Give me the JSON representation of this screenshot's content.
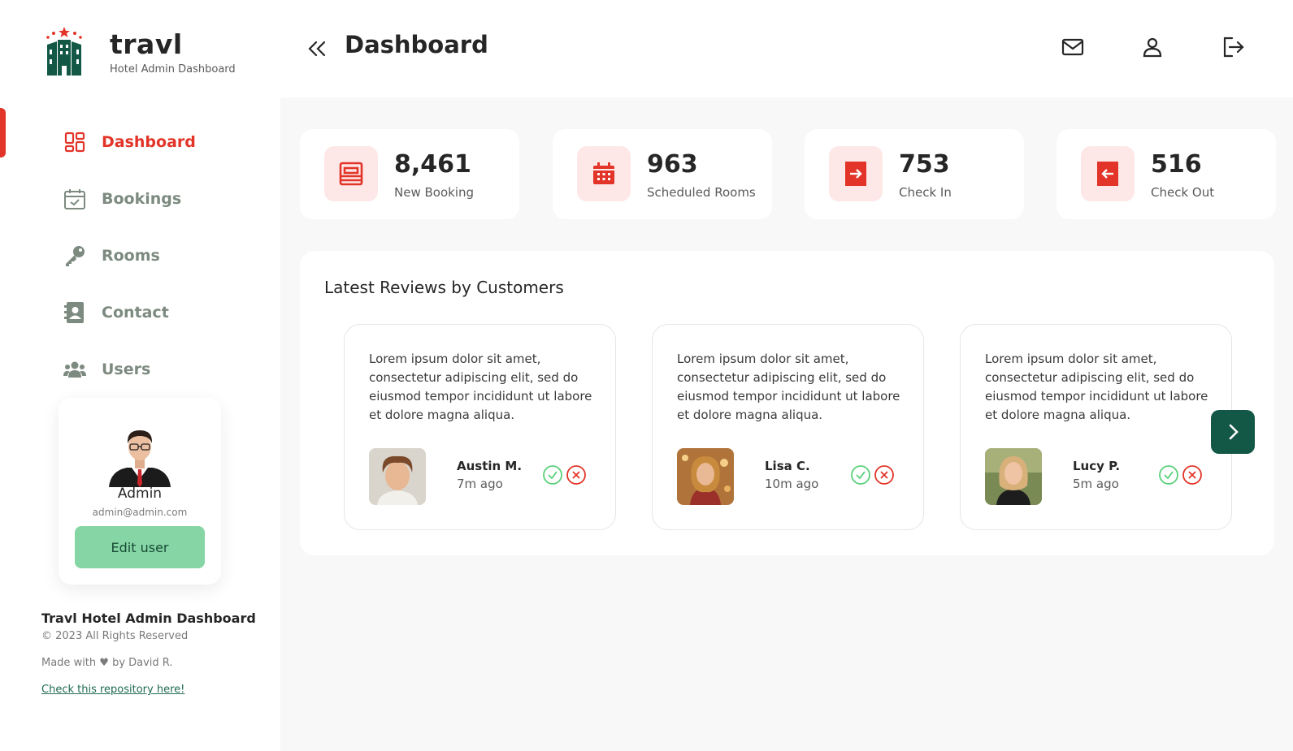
{
  "brand": {
    "name": "travl",
    "subtitle": "Hotel Admin Dashboard"
  },
  "nav": [
    {
      "label": "Dashboard",
      "icon": "dashboard-grid-icon",
      "active": true
    },
    {
      "label": "Bookings",
      "icon": "calendar-check-icon",
      "active": false
    },
    {
      "label": "Rooms",
      "icon": "key-icon",
      "active": false
    },
    {
      "label": "Contact",
      "icon": "contact-book-icon",
      "active": false
    },
    {
      "label": "Users",
      "icon": "users-icon",
      "active": false
    }
  ],
  "user": {
    "name": "Admin",
    "email": "admin@admin.com",
    "edit_label": "Edit user"
  },
  "footer": {
    "title": "Travl Hotel Admin Dashboard",
    "copyright": "© 2023 All Rights Reserved",
    "made_with": "Made with ♥ by David R.",
    "repo_link": "Check this repository here!"
  },
  "header": {
    "title": "Dashboard",
    "icons": [
      "mail-icon",
      "user-icon",
      "logout-icon"
    ]
  },
  "stats": [
    {
      "value": "8,461",
      "label": "New Booking",
      "icon": "bed-icon"
    },
    {
      "value": "963",
      "label": "Scheduled Rooms",
      "icon": "calendar-icon"
    },
    {
      "value": "753",
      "label": "Check In",
      "icon": "check-in-icon"
    },
    {
      "value": "516",
      "label": "Check Out",
      "icon": "check-out-icon"
    }
  ],
  "reviews": {
    "title": "Latest Reviews by Customers",
    "items": [
      {
        "text": "Lorem ipsum dolor sit amet, consectetur adipiscing elit, sed do eiusmod tempor incididunt ut labore et dolore magna aliqua.",
        "name": "Austin M.",
        "time": "7m ago"
      },
      {
        "text": "Lorem ipsum dolor sit amet, consectetur adipiscing elit, sed do eiusmod tempor incididunt ut labore et dolore magna aliqua.",
        "name": "Lisa C.",
        "time": "10m ago"
      },
      {
        "text": "Lorem ipsum dolor sit amet, consectetur adipiscing elit, sed do eiusmod tempor incididunt ut labore et dolore magna aliqua.",
        "name": "Lucy P.",
        "time": "5m ago"
      }
    ]
  },
  "colors": {
    "accent_red": "#e23428",
    "brand_green": "#135846",
    "edit_green": "#86d5a5",
    "muted_green": "#7c8a80",
    "approve": "#5ad07a"
  }
}
